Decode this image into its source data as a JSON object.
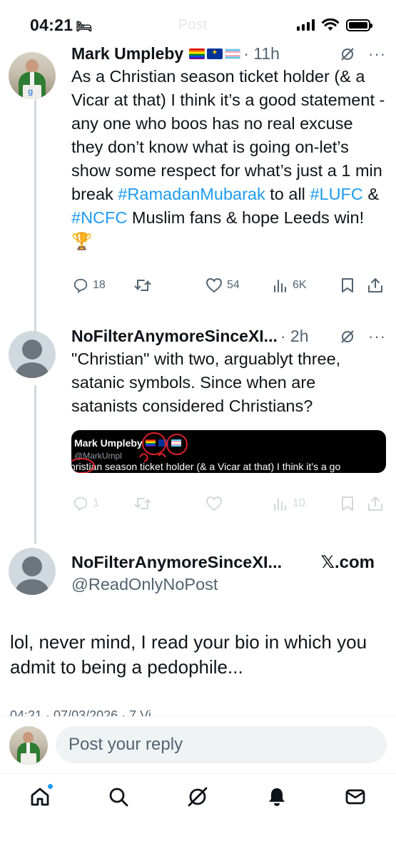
{
  "status_bar": {
    "time": "04:21",
    "sleep_icon": "bed-icon",
    "faded_title": "Post",
    "signal_icon": "cellular-signal-icon",
    "wifi_icon": "wifi-icon",
    "battery_icon": "battery-icon"
  },
  "thread": [
    {
      "name": "Mark Umpleby",
      "flags": [
        "rainbow-flag",
        "eu-flag",
        "transgender-flag"
      ],
      "time": "· 11h",
      "text_parts": [
        {
          "type": "text",
          "value": "As a Christian season ticket holder (& a Vicar at that) I think it’s a good statement - any one who boos has no real excuse they don’t know what is going on-let’s show some respect for what’s just a 1 min break "
        },
        {
          "type": "hashtag",
          "value": "#RamadanMubarak"
        },
        {
          "type": "text",
          "value": " to all "
        },
        {
          "type": "hashtag",
          "value": "#LUFC"
        },
        {
          "type": "text",
          "value": " & "
        },
        {
          "type": "hashtag",
          "value": "#NCFC"
        },
        {
          "type": "text",
          "value": " Muslim fans & hope Leeds win! 🏆"
        }
      ],
      "stats": {
        "replies": "18",
        "reposts": "",
        "likes": "54",
        "views": "6K"
      }
    },
    {
      "name": "NoFilterAnymoreSinceXI...",
      "time": "· 2h",
      "text": "\"Christian\" with two, arguablyt three, satanic symbols. Since when are satanists considered Christians?",
      "quote_image": {
        "name": "Mark Umpleby",
        "handle": "@MarkUmpl",
        "text": "hristian season ticket holder (& a Vicar at that) I think it’s a go"
      },
      "stats": {
        "replies": "1",
        "reposts": "",
        "likes": "",
        "views": "10"
      }
    }
  ],
  "main_post": {
    "name": "NoFilterAnymoreSinceXI...",
    "handle": "@ReadOnlyNoPost",
    "watermark": "𝕏.com",
    "text": "lol, never mind, I read your bio in which you admit to being a pedophile...",
    "timestamp_partial": "04:21 · 07/03/2026 · 7 Vi"
  },
  "reply_bar": {
    "placeholder": "Post your reply"
  },
  "tab_bar": {
    "items": [
      "home-icon",
      "search-icon",
      "grok-icon",
      "notifications-bell-icon",
      "messages-icon"
    ]
  },
  "colors": {
    "link": "#1d9bf0",
    "secondary_text": "#536471",
    "thread_line": "#cfd9de"
  }
}
